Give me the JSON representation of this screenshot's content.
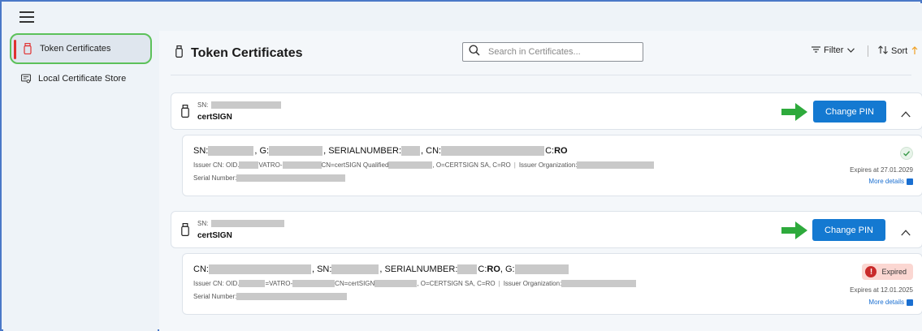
{
  "sidebar": {
    "items": [
      {
        "label": "Token Certificates",
        "icon": "usb-token-icon",
        "active": true
      },
      {
        "label": "Local Certificate Store",
        "icon": "certificate-store-icon",
        "active": false
      }
    ]
  },
  "header": {
    "title": "Token Certificates",
    "search_placeholder": "Search in Certificates...",
    "filter_label": "Filter",
    "sort_label": "Sort"
  },
  "tokens": [
    {
      "sn_label": "SN:",
      "name": "certSIGN",
      "button": "Change PIN",
      "certificate": {
        "title_parts": [
          "SN: ",
          ", G: ",
          ", SERIALNUMBER: ",
          ", CN: ",
          " C: ",
          "RO"
        ],
        "issuer_parts": [
          "Issuer CN: OID.",
          "VATRO-",
          " CN=certSIGN Qualified ",
          ", O=CERTSIGN SA, C=RO",
          "Issuer Organization: "
        ],
        "serial_label": "Serial Number: ",
        "status": "valid",
        "expires": "Expires at 27.01.2029",
        "more": "More details"
      }
    },
    {
      "sn_label": "SN:",
      "name": "certSIGN",
      "button": "Change PIN",
      "certificate": {
        "title_parts": [
          "CN: ",
          ", SN: ",
          ", SERIALNUMBER: ",
          " C: ",
          "RO",
          ", G: "
        ],
        "issuer_parts": [
          "Issuer CN: OID.",
          "=VATRO-",
          "CN=certSIGN ",
          ", O=CERTSIGN SA, C=RO",
          "Issuer Organization: "
        ],
        "serial_label": "Serial Number: ",
        "status": "expired",
        "status_label": "Expired",
        "expires": "Expires at 12.01.2025",
        "more": "More details"
      }
    }
  ],
  "colors": {
    "accent": "#1479d1",
    "active_border": "#5cc15a",
    "active_marker": "#e03131",
    "expired_bg": "#fbd7d2",
    "annotation_arrow": "#2eaa3c"
  }
}
